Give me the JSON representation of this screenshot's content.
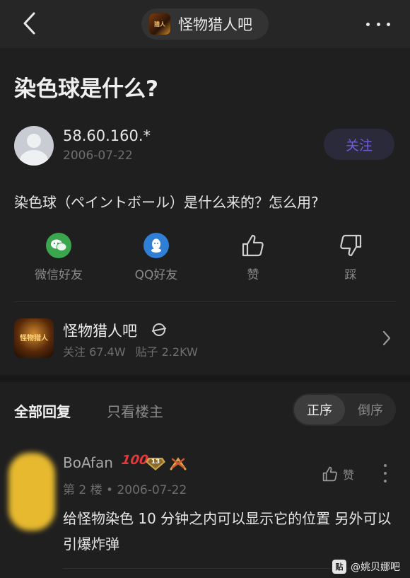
{
  "header": {
    "forum_name": "怪物猎人吧",
    "forum_thumb_text": "猎人"
  },
  "post": {
    "title": "染色球是什么?",
    "author": "58.60.160.*",
    "date": "2006-07-22",
    "follow_label": "关注",
    "body": "染色球（ペイントボール）是什么来的？怎么用?"
  },
  "actions": [
    {
      "label": "微信好友",
      "icon": "wechat-icon",
      "color": "#3aa74f"
    },
    {
      "label": "QQ好友",
      "icon": "qq-icon",
      "color": "#2f7fd6"
    },
    {
      "label": "赞",
      "icon": "thumbs-up-icon"
    },
    {
      "label": "踩",
      "icon": "thumbs-down-icon"
    }
  ],
  "forum_card": {
    "name": "怪物猎人吧",
    "logo_text": "怪物猎人",
    "follow_stat": "关注 67.4W",
    "post_stat": "贴子 2.2KW"
  },
  "reply_tabs": {
    "all": "全部回复",
    "op_only": "只看楼主",
    "sort_asc": "正序",
    "sort_desc": "倒序"
  },
  "reply": {
    "username": "BoAfan",
    "hundred_badge": "100",
    "level": "13",
    "floor_and_date": "第 2 楼 • 2006-07-22",
    "like_label": "赞",
    "text": "给怪物染色 10 分钟之内可以显示它的位置 另外可以引爆炸弹"
  },
  "watermark": {
    "icon_text": "贴",
    "text": "@姚贝娜吧"
  },
  "colors": {
    "accent": "#6f5ed8",
    "background": "#1f1f1f",
    "header": "#262626"
  }
}
